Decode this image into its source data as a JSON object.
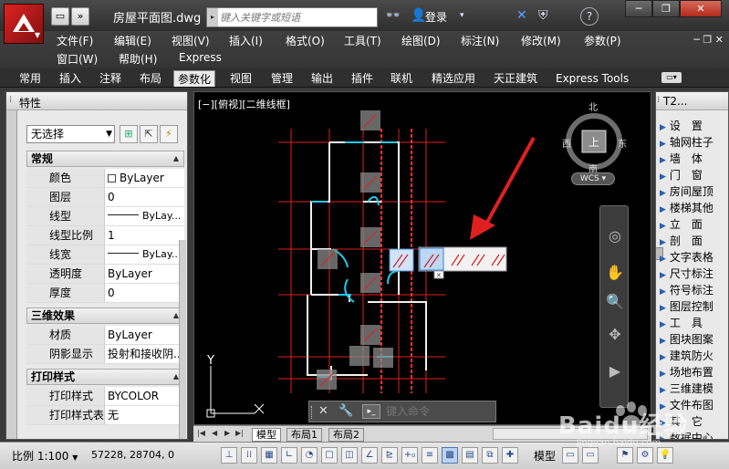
{
  "titlebar": {
    "doc_title": "房屋平面图.dwg",
    "search_placeholder": "键入关键字或短语",
    "login": "登录",
    "help": "?",
    "new_arrow": "»",
    "minimize": "─",
    "restore": "❐",
    "close": "✕"
  },
  "menubar": {
    "items": [
      "文件(F)",
      "编辑(E)",
      "视图(V)",
      "插入(I)",
      "格式(O)",
      "工具(T)",
      "绘图(D)",
      "标注(N)",
      "修改(M)",
      "参数(P)"
    ],
    "items2": [
      "窗口(W)",
      "帮助(H)",
      "Express"
    ]
  },
  "ribbon": {
    "tabs": [
      "常用",
      "插入",
      "注释",
      "布局",
      "参数化",
      "视图",
      "管理",
      "输出",
      "插件",
      "联机",
      "精选应用",
      "天正建筑",
      "Express Tools"
    ],
    "active_tab": "参数化"
  },
  "properties": {
    "title": "特性",
    "selection": "无选择",
    "sections": {
      "general": "常规",
      "effects3d": "三维效果",
      "plotstyle": "打印样式"
    },
    "general_rows": [
      {
        "key": "颜色",
        "value": "ByLayer"
      },
      {
        "key": "图层",
        "value": "0"
      },
      {
        "key": "线型",
        "value": "ByLay..."
      },
      {
        "key": "线型比例",
        "value": "1"
      },
      {
        "key": "线宽",
        "value": "ByLay..."
      },
      {
        "key": "透明度",
        "value": "ByLayer"
      },
      {
        "key": "厚度",
        "value": "0"
      }
    ],
    "effects_rows": [
      {
        "key": "材质",
        "value": "ByLayer"
      },
      {
        "key": "阴影显示",
        "value": "投射和接收阴..."
      }
    ],
    "plot_rows": [
      {
        "key": "打印样式",
        "value": "BYCOLOR"
      },
      {
        "key": "打印样式表",
        "value": "无"
      }
    ]
  },
  "canvas": {
    "view_label": "[−][俯视][二维线框]",
    "viewcube": {
      "north": "北",
      "south": "南",
      "east": "东",
      "west": "西",
      "face": "上",
      "wcs": "WCS"
    },
    "ucs_y": "Y"
  },
  "command": {
    "placeholder": "键入命令"
  },
  "layout_tabs": [
    "模型",
    "布局1",
    "布局2"
  ],
  "tool_palette": {
    "title": "T2...",
    "items": [
      "设　置",
      "轴网柱子",
      "墙　体",
      "门　窗",
      "房间屋顶",
      "楼梯其他",
      "立　面",
      "剖　面",
      "文字表格",
      "尺寸标注",
      "符号标注",
      "图层控制",
      "工　具",
      "图块图案",
      "建筑防火",
      "场地布置",
      "三维建模",
      "文件布图",
      "其　它",
      "数据中心"
    ]
  },
  "statusbar": {
    "scale": "比例 1:100",
    "coords": "57228, 28704, 0",
    "model": "模型"
  },
  "watermark": {
    "text": "Baidu经验",
    "sub": "jingyan.baidu.com"
  },
  "colors": {
    "accent_red": "#e02020",
    "cyan": "#22c8e8",
    "wall": "#f0f0f0"
  }
}
